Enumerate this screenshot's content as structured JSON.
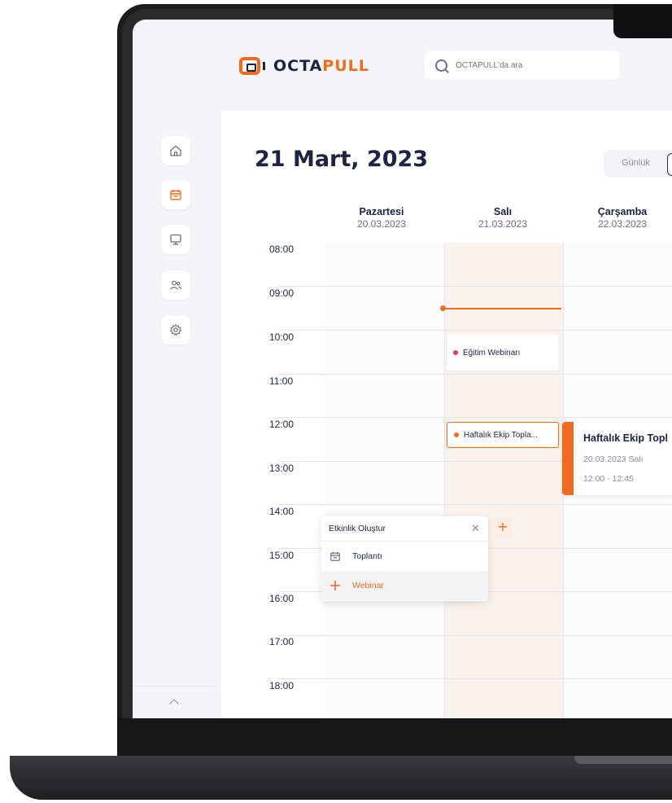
{
  "brand": {
    "text_dark": "OCTA",
    "text_orange": "PULL"
  },
  "search": {
    "placeholder": "OCTAPULL'da ara"
  },
  "sidebar": {
    "items": [
      "home",
      "calendar",
      "monitor",
      "users",
      "settings"
    ],
    "active": "calendar"
  },
  "header": {
    "title": "21 Mart, 2023",
    "view_daily": "Günlük"
  },
  "days": [
    {
      "name": "Pazartesi",
      "date": "20.03.2023"
    },
    {
      "name": "Salı",
      "date": "21.03.2023"
    },
    {
      "name": "Çarşamba",
      "date": "22.03.2023"
    }
  ],
  "hours": [
    "08:00",
    "09:00",
    "10:00",
    "11:00",
    "12:00",
    "13:00",
    "14:00",
    "15:00",
    "16:00",
    "17:00",
    "18:00"
  ],
  "events": {
    "webinar": {
      "label": "Eğitim Webinarı",
      "dot_color": "#e0337a"
    },
    "meeting_short": {
      "label": "Haftalık Ekip Topla...",
      "dot_color": "#f26b1d"
    },
    "meeting_card": {
      "title": "Haftalık Ekip Topl",
      "date": "20.03.2023 Salı",
      "time": "12:00 - 12:45"
    }
  },
  "create_popup": {
    "title": "Etkinlik Oluştur",
    "items": [
      {
        "label": "Toplantı",
        "icon": "calendar-icon"
      },
      {
        "label": "Webinar",
        "icon": "plus-icon"
      }
    ]
  },
  "colors": {
    "accent": "#f26b1d",
    "navy": "#1d2340",
    "pink": "#e0337a",
    "today_bg": "#faf2ec"
  }
}
